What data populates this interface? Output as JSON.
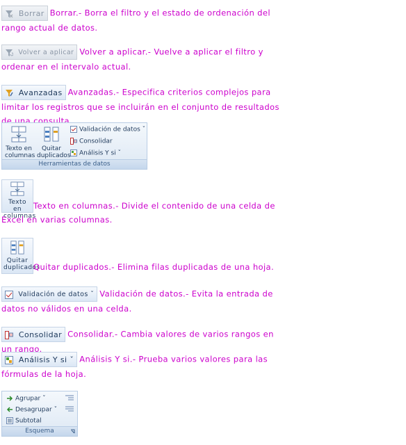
{
  "sections": {
    "borrar": {
      "button_label": "Borrar",
      "text": "Borrar.- Borra el filtro y el estado de ordenación del rango actual de datos."
    },
    "volver": {
      "button_label": "Volver a aplicar",
      "text": "Volver a aplicar.- Vuelve a aplicar el filtro y ordenar en el intervalo actual."
    },
    "avanzadas": {
      "button_label": "Avanzadas",
      "text": "Avanzadas.- Especifica criterios complejos para limitar los registros que se incluirán en el conjunto de resultados de una consulta."
    },
    "herramientas": {
      "texto_label_1": "Texto en",
      "texto_label_2": "columnas",
      "quitar_label_1": "Quitar",
      "quitar_label_2": "duplicados",
      "validacion": "Validación de datos ˇ",
      "consolidar": "Consolidar",
      "analisis": "Análisis Y si ˇ",
      "group_title": "Herramientas de datos"
    },
    "texto": {
      "button_label_1": "Texto en",
      "button_label_2": "columnas",
      "text": "Texto en columnas.- Divide el contenido de una celda de Excel en varias columnas."
    },
    "quitar": {
      "button_label_1": "Quitar",
      "button_label_2": "duplicados",
      "text": "Quitar duplicados.- Elimina filas duplicadas de una hoja."
    },
    "validacion": {
      "button_label": "Validación de datos ˇ",
      "text": "Validación de datos.- Evita la entrada de datos no válidos en una celda."
    },
    "consolidar": {
      "button_label": "Consolidar",
      "text": "Consolidar.- Cambia valores de varios rangos en un rango."
    },
    "analisis": {
      "button_label": "Análisis Y si ˇ",
      "text": "Análisis Y si.- Prueba varios valores para las fórmulas de la hoja."
    },
    "esquema": {
      "agrupar": "Agrupar ˇ",
      "desagrupar": "Desagrupar ˇ",
      "subtotal": "Subtotal",
      "group_title": "Esquema"
    }
  }
}
